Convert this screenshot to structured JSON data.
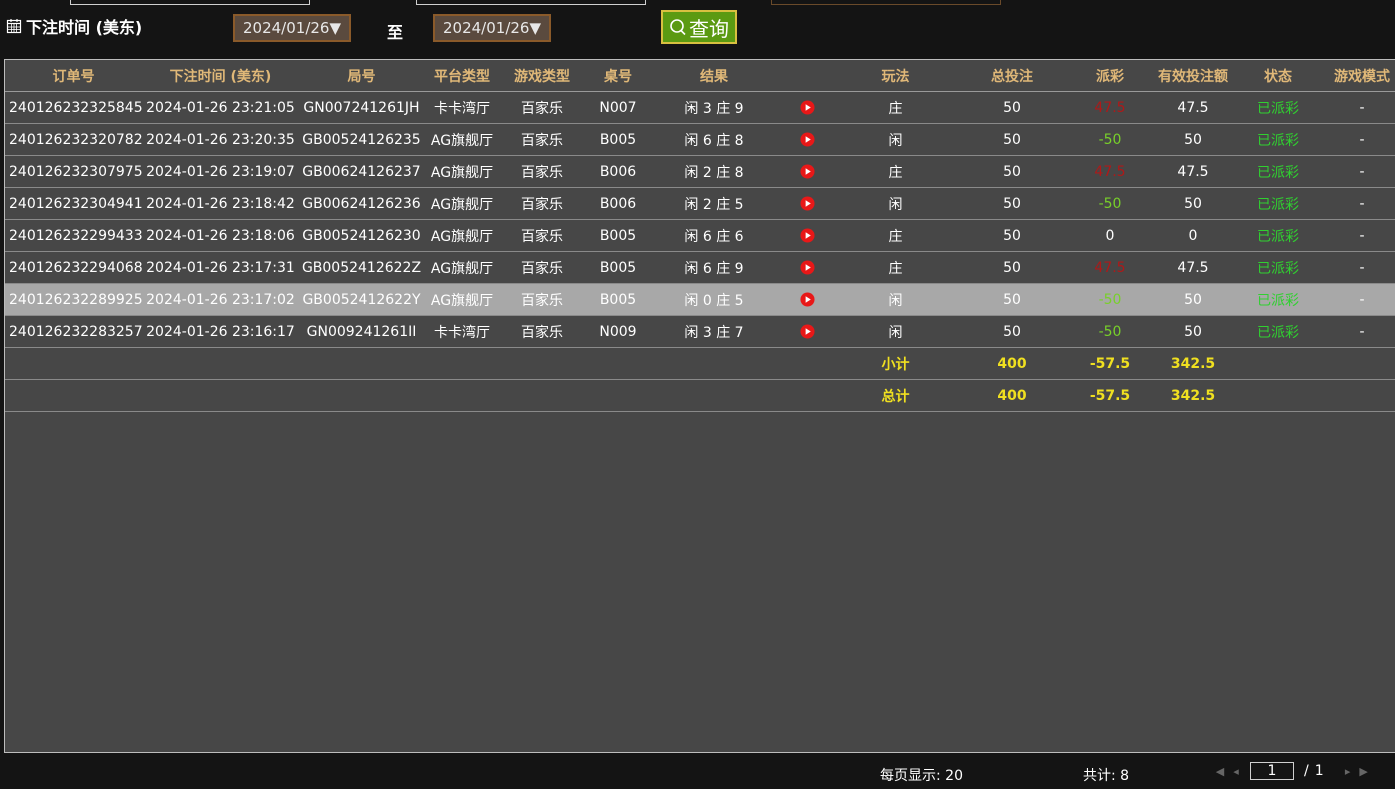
{
  "filter": {
    "label": "下注时间 (美东)",
    "start_date": "2024/01/26▼",
    "to_label": "至",
    "end_date": "2024/01/26▼",
    "query_label": "查询"
  },
  "table": {
    "headers": [
      "订单号",
      "下注时间 (美东)",
      "局号",
      "平台类型",
      "游戏类型",
      "桌号",
      "结果",
      "",
      "玩法",
      "总投注",
      "派彩",
      "有效投注额",
      "状态",
      "游戏模式"
    ],
    "rows": [
      {
        "order": "240126232325845",
        "time": "2024-01-26 23:21:05",
        "round": "GN007241261JH",
        "platform": "卡卡湾厅",
        "game": "百家乐",
        "table": "N007",
        "result": "闲 3 庄 9",
        "play": "庄",
        "bet": "50",
        "payout": "47.5",
        "payout_type": "pos",
        "valid": "47.5",
        "status": "已派彩",
        "mode": "-"
      },
      {
        "order": "240126232320782",
        "time": "2024-01-26 23:20:35",
        "round": "GB00524126235",
        "platform": "AG旗舰厅",
        "game": "百家乐",
        "table": "B005",
        "result": "闲 6 庄 8",
        "play": "闲",
        "bet": "50",
        "payout": "-50",
        "payout_type": "neg",
        "valid": "50",
        "status": "已派彩",
        "mode": "-"
      },
      {
        "order": "240126232307975",
        "time": "2024-01-26 23:19:07",
        "round": "GB00624126237",
        "platform": "AG旗舰厅",
        "game": "百家乐",
        "table": "B006",
        "result": "闲 2 庄 8",
        "play": "庄",
        "bet": "50",
        "payout": "47.5",
        "payout_type": "pos",
        "valid": "47.5",
        "status": "已派彩",
        "mode": "-"
      },
      {
        "order": "240126232304941",
        "time": "2024-01-26 23:18:42",
        "round": "GB00624126236",
        "platform": "AG旗舰厅",
        "game": "百家乐",
        "table": "B006",
        "result": "闲 2 庄 5",
        "play": "闲",
        "bet": "50",
        "payout": "-50",
        "payout_type": "neg",
        "valid": "50",
        "status": "已派彩",
        "mode": "-"
      },
      {
        "order": "240126232299433",
        "time": "2024-01-26 23:18:06",
        "round": "GB00524126230",
        "platform": "AG旗舰厅",
        "game": "百家乐",
        "table": "B005",
        "result": "闲 6 庄 6",
        "play": "庄",
        "bet": "50",
        "payout": "0",
        "payout_type": "zero",
        "valid": "0",
        "status": "已派彩",
        "mode": "-"
      },
      {
        "order": "240126232294068",
        "time": "2024-01-26 23:17:31",
        "round": "GB0052412622Z",
        "platform": "AG旗舰厅",
        "game": "百家乐",
        "table": "B005",
        "result": "闲 6 庄 9",
        "play": "庄",
        "bet": "50",
        "payout": "47.5",
        "payout_type": "pos",
        "valid": "47.5",
        "status": "已派彩",
        "mode": "-"
      },
      {
        "order": "240126232289925",
        "time": "2024-01-26 23:17:02",
        "round": "GB0052412622Y",
        "platform": "AG旗舰厅",
        "game": "百家乐",
        "table": "B005",
        "result": "闲 0 庄 5",
        "play": "闲",
        "bet": "50",
        "payout": "-50",
        "payout_type": "neg",
        "valid": "50",
        "status": "已派彩",
        "mode": "-",
        "highlighted": true
      },
      {
        "order": "240126232283257",
        "time": "2024-01-26 23:16:17",
        "round": "GN009241261II",
        "platform": "卡卡湾厅",
        "game": "百家乐",
        "table": "N009",
        "result": "闲 3 庄 7",
        "play": "闲",
        "bet": "50",
        "payout": "-50",
        "payout_type": "neg",
        "valid": "50",
        "status": "已派彩",
        "mode": "-"
      }
    ],
    "subtotal": {
      "label": "小计",
      "bet": "400",
      "payout": "-57.5",
      "valid": "342.5"
    },
    "total": {
      "label": "总计",
      "bet": "400",
      "payout": "-57.5",
      "valid": "342.5"
    }
  },
  "footer": {
    "per_page": "每页显示: 20",
    "total_count": "共计: 8",
    "current_page": "1",
    "page_sep": "/",
    "total_pages": "1"
  },
  "colors": {
    "header_text": "#e0b878",
    "negative": "#78d02a",
    "positive": "#b01818",
    "status": "#30d030",
    "sum": "#f0e020",
    "query_button": "#5b9a12"
  }
}
